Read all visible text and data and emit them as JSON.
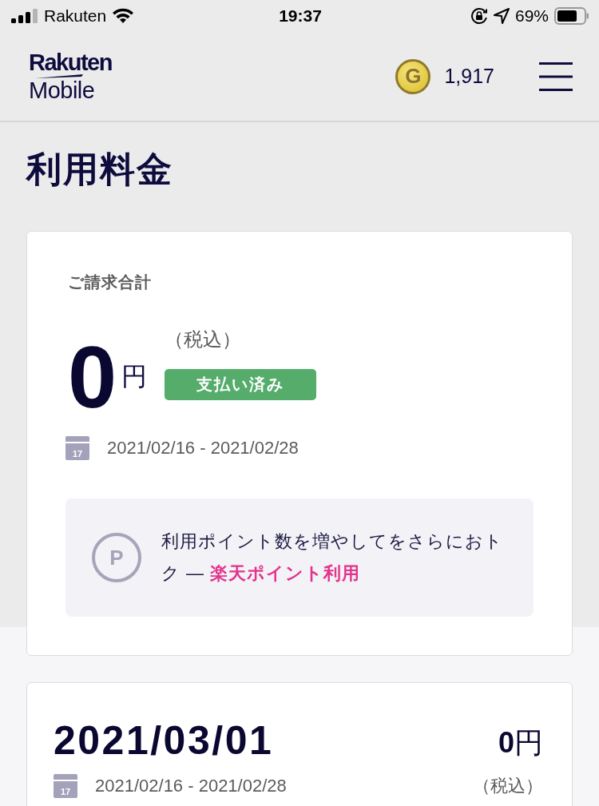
{
  "status_bar": {
    "carrier": "Rakuten",
    "time": "19:37",
    "battery": "69%"
  },
  "header": {
    "logo_top": "Rakuten",
    "logo_bottom": "Mobile",
    "coin_letter": "G",
    "points": "1,917"
  },
  "page_title": "利用料金",
  "billing_summary": {
    "label": "ご請求合計",
    "amount": "0",
    "currency": "円",
    "tax_note": "（税込）",
    "status_badge": "支払い済み",
    "calendar_day": "17",
    "period": "2021/02/16 - 2021/02/28",
    "points_promo": {
      "icon_letter": "P",
      "text": "利用ポイント数を増やしてをさらにおトク — ",
      "link": "楽天ポイント利用"
    }
  },
  "bills": [
    {
      "date": "2021/03/01",
      "amount": "**0**円",
      "calendar_day": "17",
      "period": "2021/02/16 - 2021/02/28",
      "tax_note": "（税込）"
    }
  ]
}
